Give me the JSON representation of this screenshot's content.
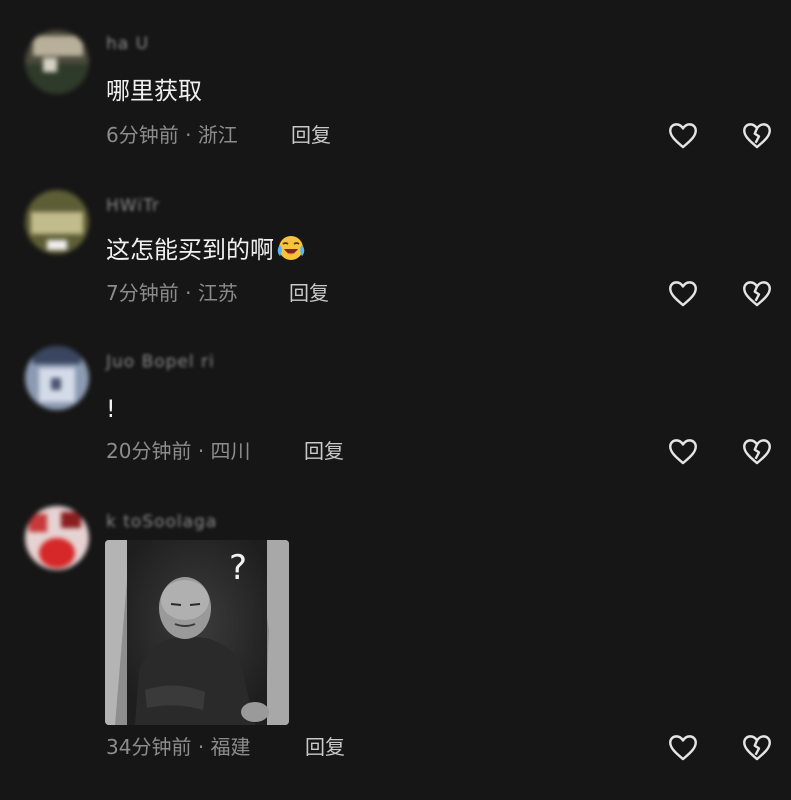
{
  "comments": [
    {
      "username": "ha U",
      "text": "哪里获取",
      "time": "6分钟前",
      "location": "浙江",
      "reply_label": "回复",
      "avatar_colors": [
        "#5d5a48",
        "#b8b09a",
        "#2e3a2a"
      ]
    },
    {
      "username": "HWiTr",
      "text": "这怎能买到的啊",
      "emoji": "laughing-crying-emoji",
      "time": "7分钟前",
      "location": "江苏",
      "reply_label": "回复",
      "avatar_colors": [
        "#6a6a3e",
        "#c2bc8c",
        "#eeeeee"
      ]
    },
    {
      "username": "Juo Bopel ri",
      "text": "!",
      "time": "20分钟前",
      "location": "四川",
      "reply_label": "回复",
      "avatar_colors": [
        "#7f8ea8",
        "#c9d2e2",
        "#3a4660"
      ]
    },
    {
      "username": "k toSoolaga",
      "text": "",
      "image": "meme-photo",
      "image_text": "?",
      "time": "34分钟前",
      "location": "福建",
      "reply_label": "回复",
      "avatar_colors": [
        "#c83a3a",
        "#f0d6d6",
        "#8a1e1e"
      ]
    }
  ],
  "meta_separator": "·",
  "icons": {
    "like": "heart-outline-icon",
    "dislike": "broken-heart-outline-icon"
  },
  "colors": {
    "background": "#161616",
    "text": "#f0f0f0",
    "meta": "#8c8c8c"
  }
}
